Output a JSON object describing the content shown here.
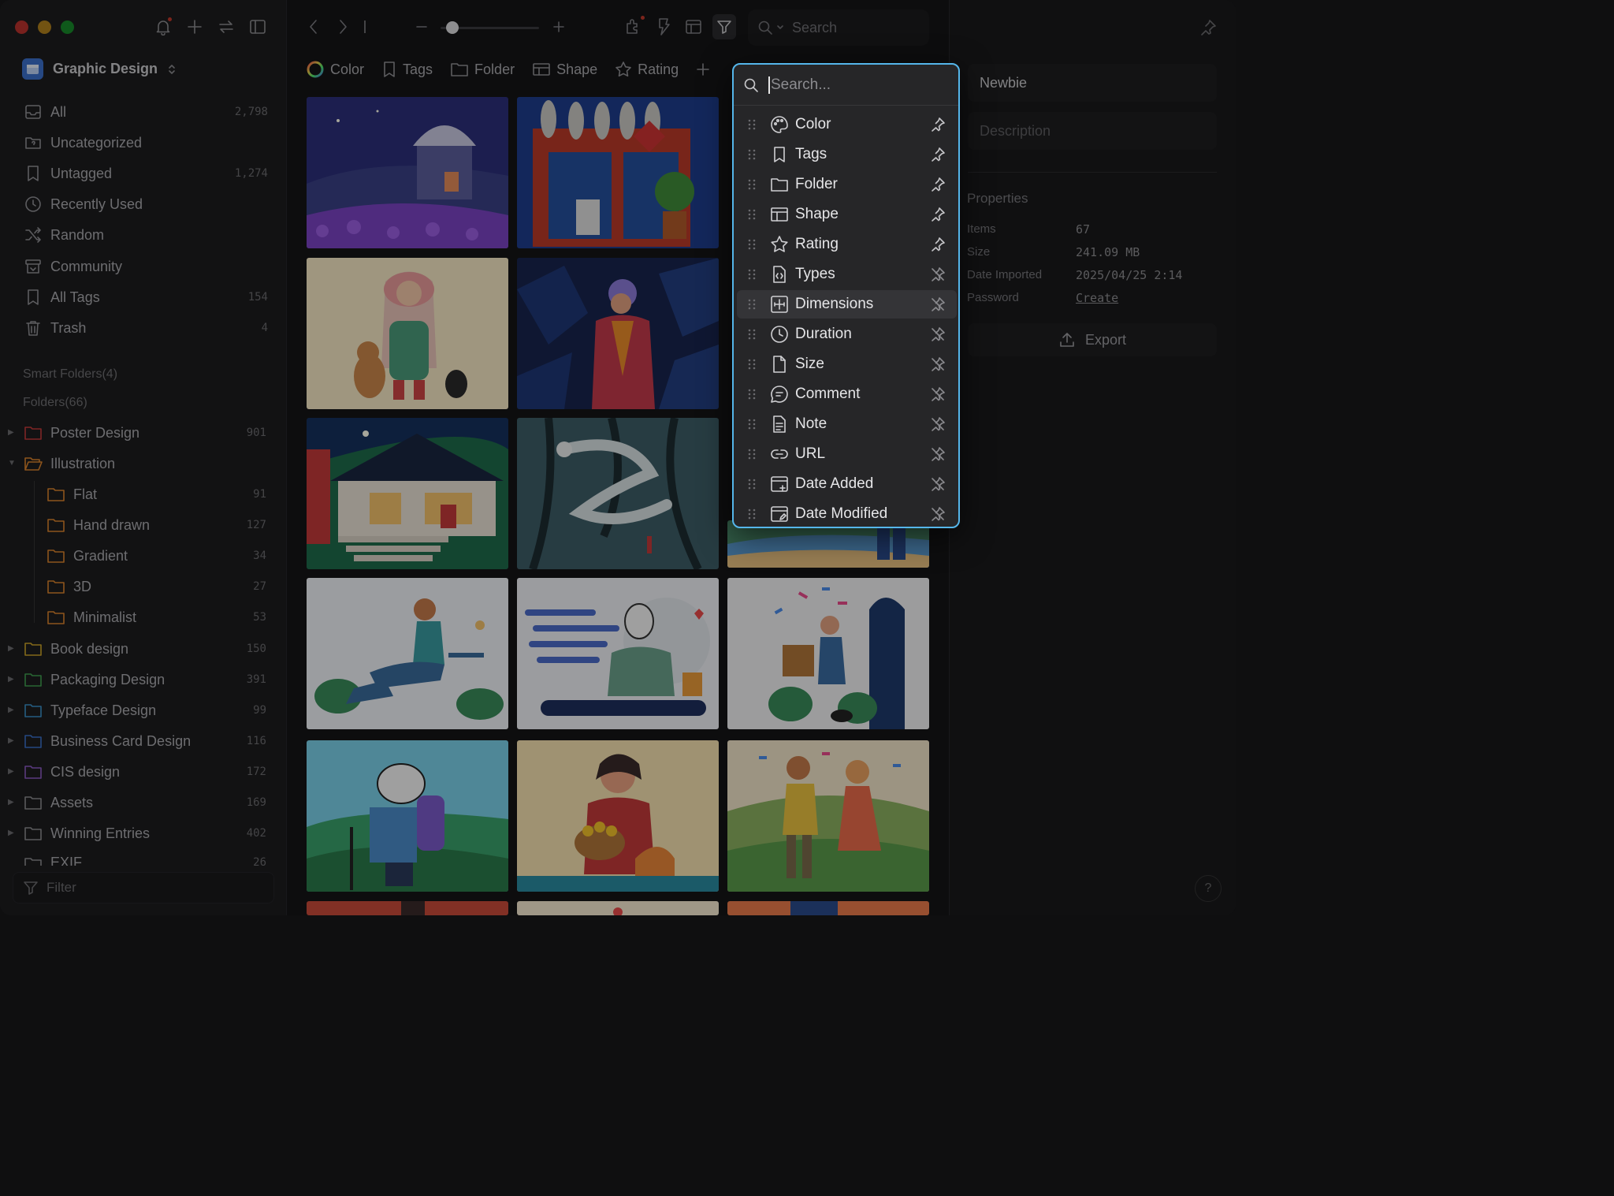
{
  "sidebar": {
    "library_name": "Graphic Design",
    "nav": [
      {
        "label": "All",
        "count": "2,798",
        "icon": "inbox-icon"
      },
      {
        "label": "Uncategorized",
        "count": "",
        "icon": "folder-question-icon"
      },
      {
        "label": "Untagged",
        "count": "1,274",
        "icon": "tag-question-icon"
      },
      {
        "label": "Recently Used",
        "count": "",
        "icon": "clock-icon"
      },
      {
        "label": "Random",
        "count": "",
        "icon": "shuffle-icon"
      },
      {
        "label": "Community",
        "count": "",
        "icon": "community-icon"
      },
      {
        "label": "All Tags",
        "count": "154",
        "icon": "bookmark-icon"
      },
      {
        "label": "Trash",
        "count": "4",
        "icon": "trash-icon"
      }
    ],
    "smart_folders": "Smart Folders(4)",
    "folders_header": "Folders(66)",
    "folders": [
      {
        "label": "Poster Design",
        "count": "901",
        "color": "#c23a3a"
      },
      {
        "label": "Illustration",
        "count": "",
        "color": "#d9822b"
      },
      {
        "label": "Flat",
        "count": "91",
        "color": "#d9822b"
      },
      {
        "label": "Hand drawn",
        "count": "127",
        "color": "#d9822b"
      },
      {
        "label": "Gradient",
        "count": "34",
        "color": "#d9822b"
      },
      {
        "label": "3D",
        "count": "27",
        "color": "#d9822b"
      },
      {
        "label": "Minimalist",
        "count": "53",
        "color": "#d9822b"
      },
      {
        "label": "Book design",
        "count": "150",
        "color": "#c9a227"
      },
      {
        "label": "Packaging Design",
        "count": "391",
        "color": "#3f9d4f"
      },
      {
        "label": "Typeface Design",
        "count": "99",
        "color": "#3a8fc7"
      },
      {
        "label": "Business Card Design",
        "count": "116",
        "color": "#3a6fc7"
      },
      {
        "label": "CIS design",
        "count": "172",
        "color": "#8a5ac2"
      },
      {
        "label": "Assets",
        "count": "169",
        "color": "#8a8a8e"
      },
      {
        "label": "Winning Entries",
        "count": "402",
        "color": "#8a8a8e"
      },
      {
        "label": "EXIF",
        "count": "26",
        "color": "#8a8a8e"
      }
    ],
    "filter_placeholder": "Filter"
  },
  "toolbar": {
    "search_placeholder": "Search"
  },
  "filter_chips": [
    "Color",
    "Tags",
    "Folder",
    "Shape",
    "Rating"
  ],
  "popup": {
    "search_placeholder": "Search...",
    "items": [
      {
        "label": "Color",
        "icon": "palette-icon",
        "pinned": true
      },
      {
        "label": "Tags",
        "icon": "bookmark-icon",
        "pinned": true
      },
      {
        "label": "Folder",
        "icon": "folder-icon",
        "pinned": true
      },
      {
        "label": "Shape",
        "icon": "shape-icon",
        "pinned": true
      },
      {
        "label": "Rating",
        "icon": "star-icon",
        "pinned": true
      },
      {
        "label": "Types",
        "icon": "file-code-icon",
        "pinned": false
      },
      {
        "label": "Dimensions",
        "icon": "dimensions-icon",
        "pinned": false,
        "highlighted": true
      },
      {
        "label": "Duration",
        "icon": "clock-icon",
        "pinned": false
      },
      {
        "label": "Size",
        "icon": "file-icon",
        "pinned": false
      },
      {
        "label": "Comment",
        "icon": "comment-icon",
        "pinned": false
      },
      {
        "label": "Note",
        "icon": "note-icon",
        "pinned": false
      },
      {
        "label": "URL",
        "icon": "link-icon",
        "pinned": false
      },
      {
        "label": "Date Added",
        "icon": "calendar-plus-icon",
        "pinned": false
      },
      {
        "label": "Date Modified",
        "icon": "calendar-edit-icon",
        "pinned": false
      }
    ]
  },
  "inspector": {
    "name_value": "Newbie",
    "description_placeholder": "Description",
    "properties_title": "Properties",
    "properties": [
      {
        "key": "Items",
        "value": "67"
      },
      {
        "key": "Size",
        "value": "241.09 MB"
      },
      {
        "key": "Date Imported",
        "value": "2025/04/25 2:14"
      },
      {
        "key": "Password",
        "value": "Create"
      }
    ],
    "export_label": "Export"
  },
  "help_label": "?",
  "colors": {
    "accent": "#55b6ea",
    "traffic_red": "#e0443e",
    "traffic_yellow": "#dea123",
    "traffic_green": "#1aab29"
  }
}
